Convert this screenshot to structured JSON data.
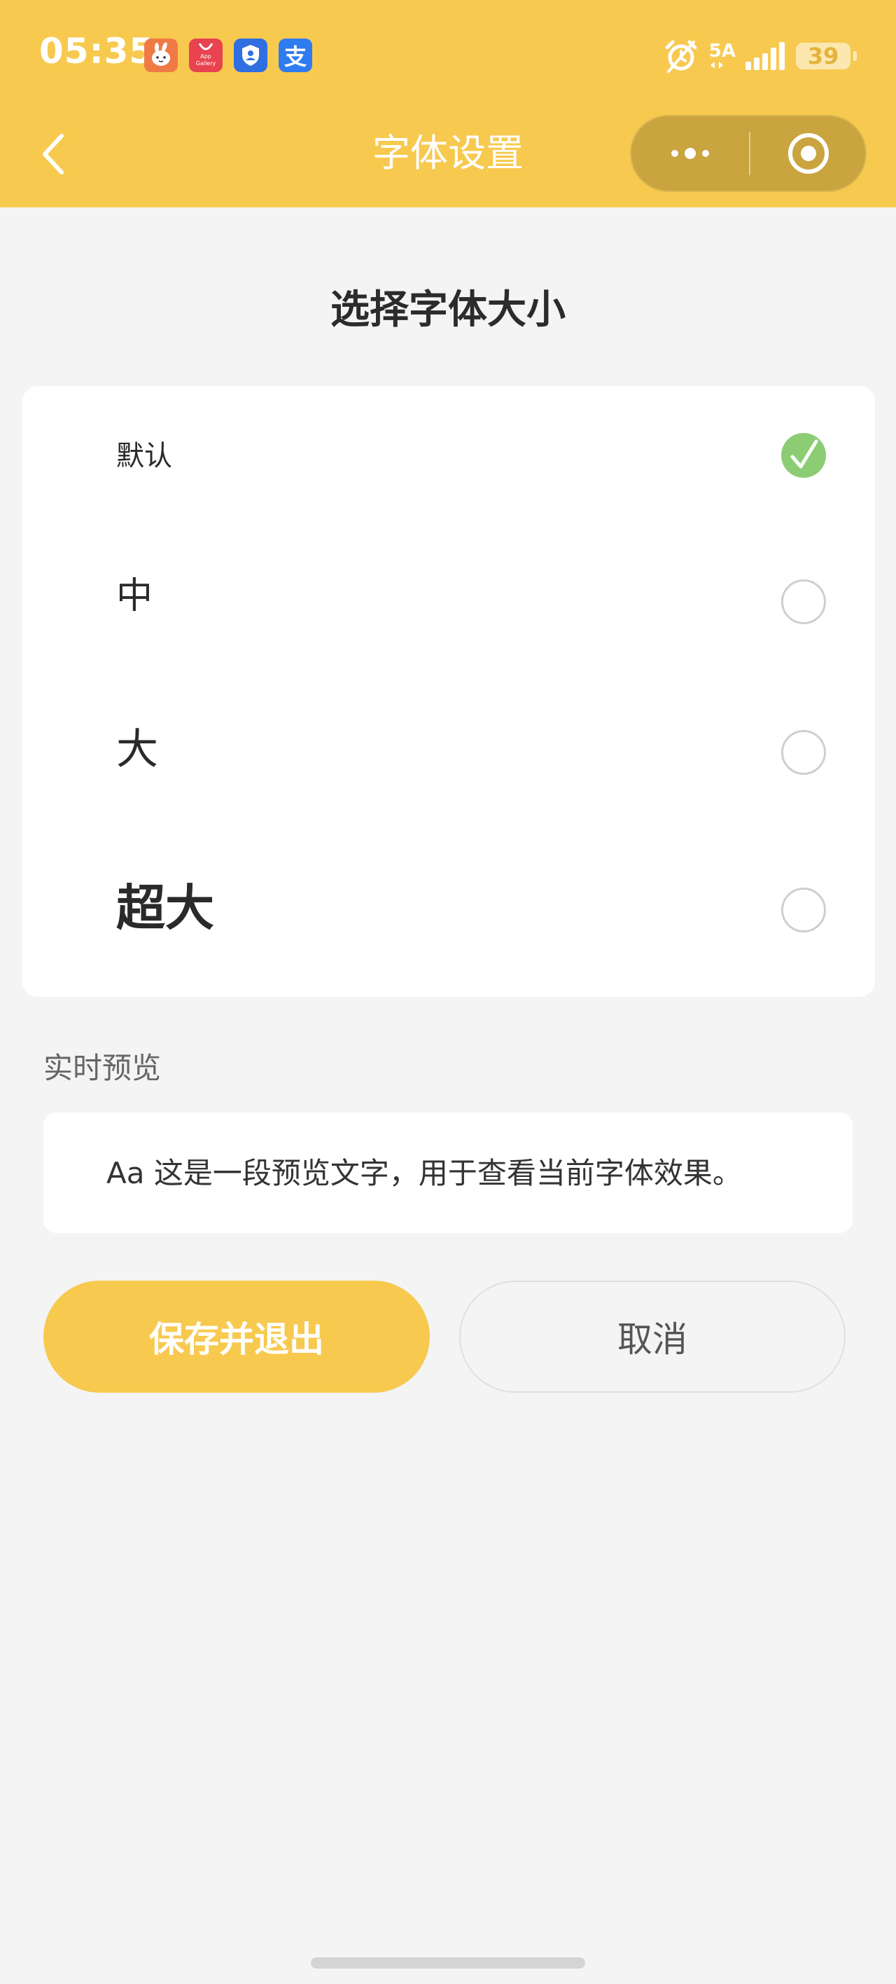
{
  "status_bar": {
    "time": "05:35",
    "app_icons": [
      {
        "name": "rabbit-app-icon",
        "color": "#f07a45",
        "glyph": "🐰"
      },
      {
        "name": "app-gallery-icon",
        "color": "#e8434f",
        "glyph": "App Gallery"
      },
      {
        "name": "security-shield-icon",
        "color": "#2f6fe0",
        "glyph": "⛨"
      },
      {
        "name": "alipay-icon",
        "color": "#2f7cf0",
        "glyph": "支"
      }
    ],
    "network": "5A",
    "battery": "39",
    "battery_level_percent": 39
  },
  "navbar": {
    "title": "字体设置"
  },
  "page": {
    "section_title": "选择字体大小",
    "options": [
      {
        "label": "默认",
        "checked": true
      },
      {
        "label": "中",
        "checked": false
      },
      {
        "label": "大",
        "checked": false
      },
      {
        "label": "超大",
        "checked": false
      }
    ],
    "preview_label": "实时预览",
    "preview_text": "Aa 这是一段预览文字，用于查看当前字体效果。",
    "save_label": "保存并退出",
    "cancel_label": "取消"
  },
  "colors": {
    "accent": "#f7c94f",
    "check_green": "#8ccd74",
    "background": "#f4f4f4"
  }
}
